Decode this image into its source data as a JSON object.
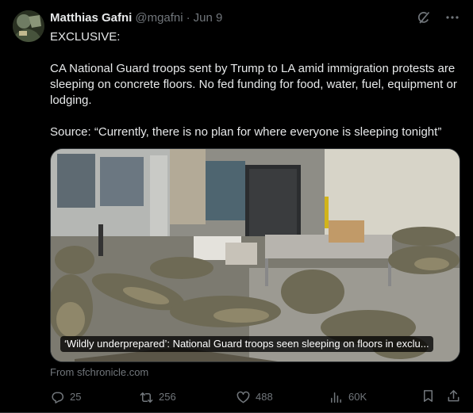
{
  "tweet": {
    "author": {
      "name": "Matthias Gafni",
      "handle": "@mgafni",
      "separator": "·",
      "date": "Jun 9"
    },
    "header_icons": [
      "grok-icon",
      "more-icon"
    ],
    "text": {
      "line1": "EXCLUSIVE:",
      "para2": "CA National Guard troops sent by Trump to LA amid immigration protests are sleeping on concrete floors. No fed funding for food, water, fuel, equipment or lodging.",
      "para3": "Source: “Currently, there is no plan for where everyone is sleeping tonight”"
    },
    "card": {
      "caption": "‘Wildly underprepared’: National Guard troops seen sleeping on floors in exclu...",
      "source": "From sfchronicle.com"
    },
    "actions": {
      "replies": "25",
      "reposts": "256",
      "likes": "488",
      "views": "60K"
    }
  }
}
